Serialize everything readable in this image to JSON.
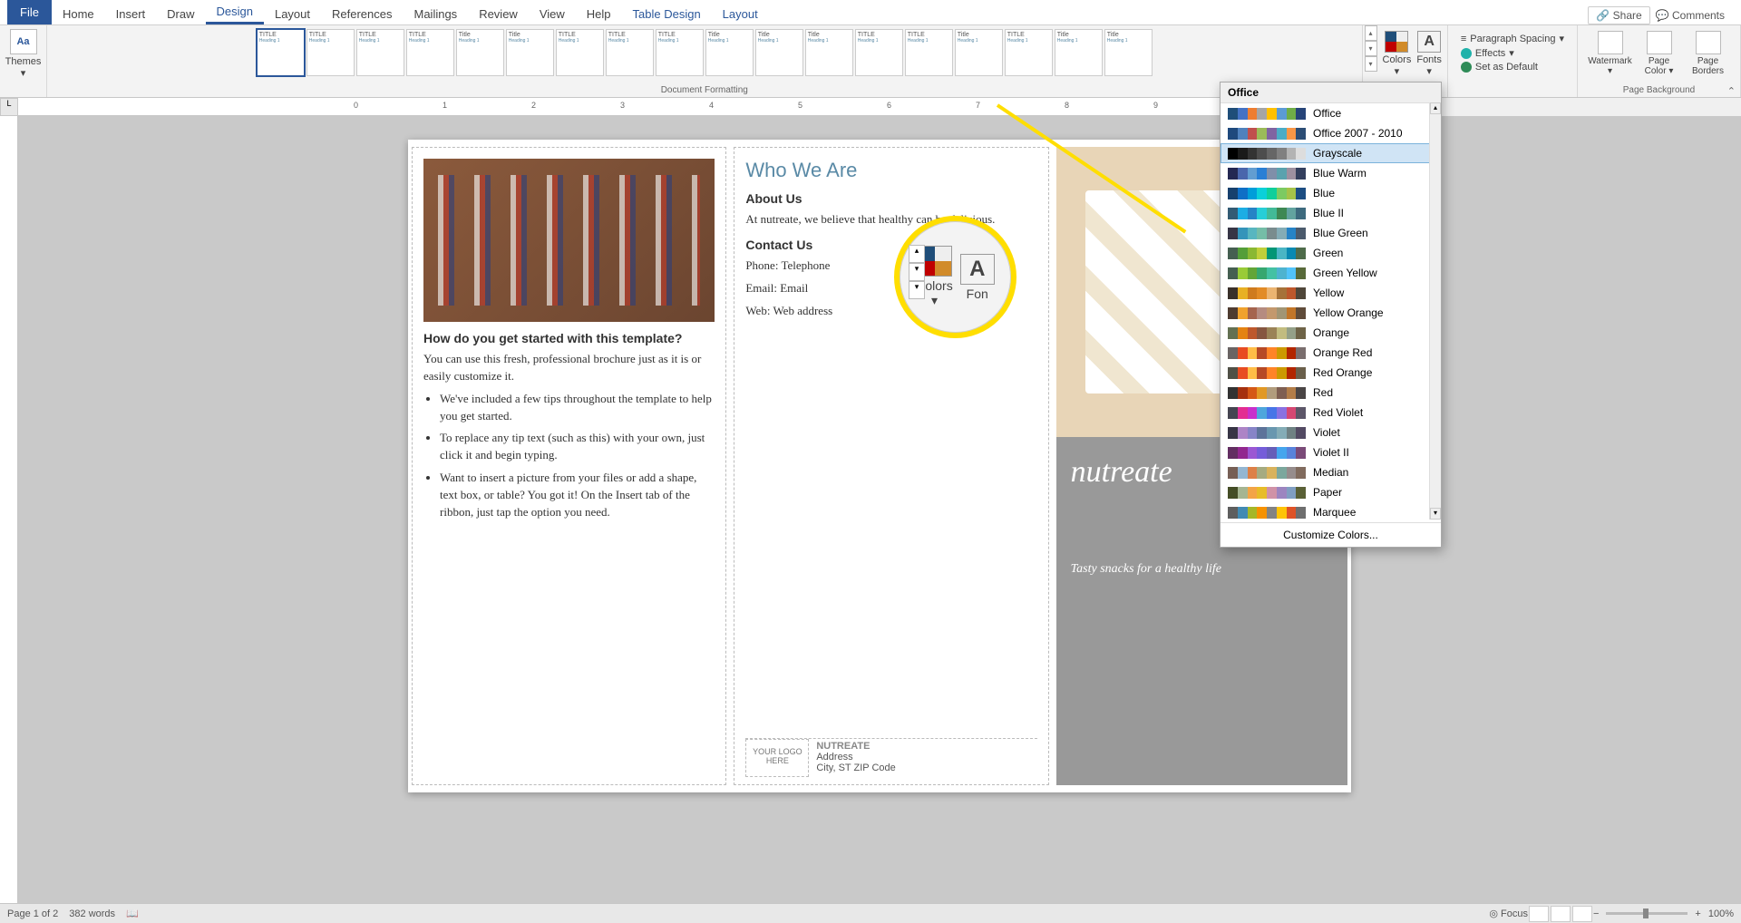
{
  "tabs": {
    "file": "File",
    "home": "Home",
    "insert": "Insert",
    "draw": "Draw",
    "design": "Design",
    "layout": "Layout",
    "references": "References",
    "mailings": "Mailings",
    "review": "Review",
    "view": "View",
    "help": "Help",
    "table_design": "Table Design",
    "table_layout": "Layout"
  },
  "top_right": {
    "share": "Share",
    "comments": "Comments"
  },
  "ribbon": {
    "themes": "Themes",
    "doc_formatting": "Document Formatting",
    "colors": "Colors",
    "fonts": "Fonts",
    "para_spacing": "Paragraph Spacing",
    "effects": "Effects",
    "set_default": "Set as Default",
    "watermark": "Watermark",
    "page_color": "Page Color",
    "page_borders": "Page Borders",
    "page_background": "Page Background"
  },
  "style_names": [
    "TITLE",
    "TITLE",
    "TITLE",
    "TITLE",
    "Title",
    "Title",
    "TITLE",
    "TITLE",
    "TITLE",
    "Title",
    "Title",
    "Title",
    "TITLE",
    "TITLE",
    "Title",
    "TITLE",
    "Title",
    "Title"
  ],
  "colors_menu": {
    "header": "Office",
    "items": [
      {
        "label": "Office",
        "c": [
          "#1f4e79",
          "#4472c4",
          "#ed7d31",
          "#a5a5a5",
          "#ffc000",
          "#5b9bd5",
          "#70ad47",
          "#264478"
        ]
      },
      {
        "label": "Office 2007 - 2010",
        "c": [
          "#1f497d",
          "#4f81bd",
          "#c0504d",
          "#9bbb59",
          "#8064a2",
          "#4bacc6",
          "#f79646",
          "#2c4d75"
        ]
      },
      {
        "label": "Grayscale",
        "c": [
          "#000",
          "#1a1a1a",
          "#333",
          "#4d4d4d",
          "#666",
          "#808080",
          "#b3b3b3",
          "#ddd"
        ],
        "hov": true
      },
      {
        "label": "Blue Warm",
        "c": [
          "#242852",
          "#4a66ac",
          "#629dd1",
          "#297fd5",
          "#7f8fa9",
          "#5aa2ae",
          "#9d90a0",
          "#333f5e"
        ]
      },
      {
        "label": "Blue",
        "c": [
          "#17406d",
          "#0f6fc6",
          "#009dd9",
          "#0bd0d9",
          "#10cf9b",
          "#7cca62",
          "#a5c249",
          "#1c4d82"
        ]
      },
      {
        "label": "Blue II",
        "c": [
          "#335b74",
          "#1cade4",
          "#2683c6",
          "#27ced7",
          "#42ba97",
          "#3e8853",
          "#62a39f",
          "#3d6a7e"
        ]
      },
      {
        "label": "Blue Green",
        "c": [
          "#373545",
          "#3494ba",
          "#58b6c0",
          "#75bda7",
          "#7a8c8e",
          "#84acb6",
          "#2683c6",
          "#4b5a6c"
        ]
      },
      {
        "label": "Green",
        "c": [
          "#455f51",
          "#549e39",
          "#8ab833",
          "#c0cf3a",
          "#029676",
          "#4ab5c4",
          "#0989b1",
          "#4e6b4a"
        ]
      },
      {
        "label": "Green Yellow",
        "c": [
          "#455f51",
          "#99cb38",
          "#63a537",
          "#37a76f",
          "#44c1a3",
          "#4eb3cf",
          "#51c3f9",
          "#586a3a"
        ]
      },
      {
        "label": "Yellow",
        "c": [
          "#39302a",
          "#e8b024",
          "#cf7b1e",
          "#e28b26",
          "#ebb471",
          "#a67239",
          "#bd582c",
          "#4f4639"
        ]
      },
      {
        "label": "Yellow Orange",
        "c": [
          "#4e3b30",
          "#f0a22e",
          "#a5644e",
          "#b58b80",
          "#c3986d",
          "#a19574",
          "#c17529",
          "#5f4b3a"
        ]
      },
      {
        "label": "Orange",
        "c": [
          "#637052",
          "#e48312",
          "#bd582c",
          "#865640",
          "#9b8357",
          "#c2bc80",
          "#94a088",
          "#6e6347"
        ]
      },
      {
        "label": "Orange Red",
        "c": [
          "#696464",
          "#e84c22",
          "#ffbd47",
          "#b64926",
          "#ff8427",
          "#cc9900",
          "#b22600",
          "#7a6e6e"
        ]
      },
      {
        "label": "Red Orange",
        "c": [
          "#505046",
          "#e84c22",
          "#ffbd47",
          "#b64926",
          "#ff8427",
          "#cc9900",
          "#b22600",
          "#6a5f4b"
        ]
      },
      {
        "label": "Red",
        "c": [
          "#323232",
          "#a5300f",
          "#d55816",
          "#e19825",
          "#b19c7d",
          "#7f5f52",
          "#b27d49",
          "#4a4545"
        ]
      },
      {
        "label": "Red Violet",
        "c": [
          "#454551",
          "#e32d91",
          "#c830cc",
          "#4ea6dc",
          "#4775e7",
          "#8971e1",
          "#d54773",
          "#5c5668"
        ]
      },
      {
        "label": "Violet",
        "c": [
          "#373545",
          "#ad84c6",
          "#8784c7",
          "#5d739a",
          "#6997af",
          "#84acb6",
          "#6f8183",
          "#534a63"
        ]
      },
      {
        "label": "Violet II",
        "c": [
          "#632e62",
          "#92278f",
          "#9b57d3",
          "#755dd9",
          "#665eb8",
          "#45a5ed",
          "#5982db",
          "#7a4a78"
        ]
      },
      {
        "label": "Median",
        "c": [
          "#775f55",
          "#94b6d2",
          "#dd8047",
          "#a5ab81",
          "#d8b25c",
          "#7ba79d",
          "#968c8c",
          "#816b5e"
        ]
      },
      {
        "label": "Paper",
        "c": [
          "#444d26",
          "#a5b592",
          "#f3a447",
          "#e7bc29",
          "#d092a7",
          "#9c85c0",
          "#809ec2",
          "#5a6036"
        ]
      },
      {
        "label": "Marquee",
        "c": [
          "#5e5e5e",
          "#418ab3",
          "#a6b727",
          "#f69200",
          "#838383",
          "#fec306",
          "#df5327",
          "#6e6e6e"
        ]
      }
    ],
    "customize": "Customize Colors..."
  },
  "doc": {
    "panel1": {
      "q": "How do you get started with this template?",
      "p1": "You can use this fresh, professional brochure just as it is or easily customize it.",
      "li1": "We've included a few tips throughout the template to help you get started.",
      "li2": "To replace any tip text (such as this) with your own, just click it and begin typing.",
      "li3": "Want to insert a picture from your files or add a shape, text box, or table? You got it! On the Insert tab of the ribbon, just tap the option you need."
    },
    "panel2": {
      "title": "Who We Are",
      "about_h": "About Us",
      "about_p": "At nutreate, we believe that healthy can be delicious.",
      "contact_h": "Contact Us",
      "phone": "Phone: Telephone",
      "email": "Email: Email",
      "web": "Web: Web address",
      "logo": "YOUR LOGO HERE",
      "company": "NUTREATE",
      "addr1": "Address",
      "addr2": "City, ST ZIP Code"
    },
    "panel3": {
      "brand": "nutreate",
      "tagline": "Tasty snacks for a healthy life"
    }
  },
  "status": {
    "page": "Page 1 of 2",
    "words": "382 words",
    "focus": "Focus",
    "zoom": "100%"
  },
  "callout": {
    "colors": "Colors",
    "fonts": "Fon"
  }
}
